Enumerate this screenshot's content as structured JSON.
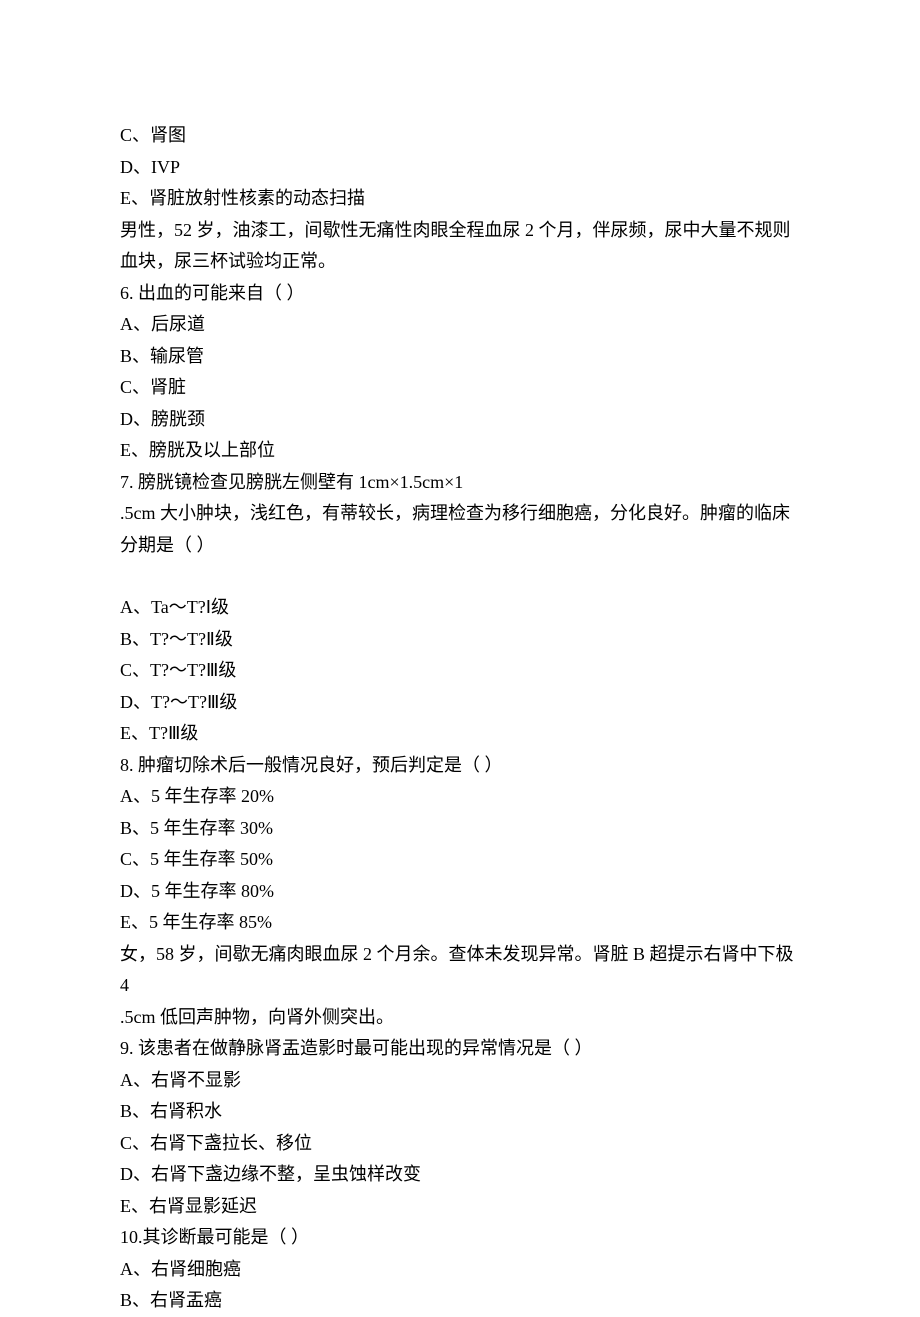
{
  "lines": [
    "C、肾图",
    "D、IVP",
    "E、肾脏放射性核素的动态扫描",
    "男性，52 岁，油漆工，间歇性无痛性肉眼全程血尿 2 个月，伴尿频，尿中大量不规则血块，尿三杯试验均正常。",
    "6. 出血的可能来自（ ）",
    "A、后尿道",
    "B、输尿管",
    "C、肾脏",
    "D、膀胱颈",
    "E、膀胱及以上部位",
    "7. 膀胱镜检查见膀胱左侧壁有 1cm×1.5cm×1",
    ".5cm 大小肿块，浅红色，有蒂较长，病理检查为移行细胞癌，分化良好。肿瘤的临床分期是（ ）",
    "",
    "A、Ta～T?Ⅰ级",
    "B、T?～T?Ⅱ级",
    "C、T?～T?Ⅲ级",
    "D、T?～T?Ⅲ级",
    "E、T?Ⅲ级",
    "8. 肿瘤切除术后一般情况良好，预后判定是（ ）",
    "A、5 年生存率 20%",
    "B、5 年生存率 30%",
    "C、5 年生存率 50%",
    "D、5 年生存率 80%",
    "E、5 年生存率 85%",
    "女，58 岁，间歇无痛肉眼血尿 2 个月余。查体未发现异常。肾脏 B 超提示右肾中下极 4",
    ".5cm 低回声肿物，向肾外侧突出。",
    "9. 该患者在做静脉肾盂造影时最可能出现的异常情况是（ ）",
    "A、右肾不显影",
    "B、右肾积水",
    "C、右肾下盏拉长、移位",
    "D、右肾下盏边缘不整，呈虫蚀样改变",
    "E、右肾显影延迟",
    "10.其诊断最可能是（ ）",
    "A、右肾细胞癌",
    "B、右肾盂癌"
  ]
}
